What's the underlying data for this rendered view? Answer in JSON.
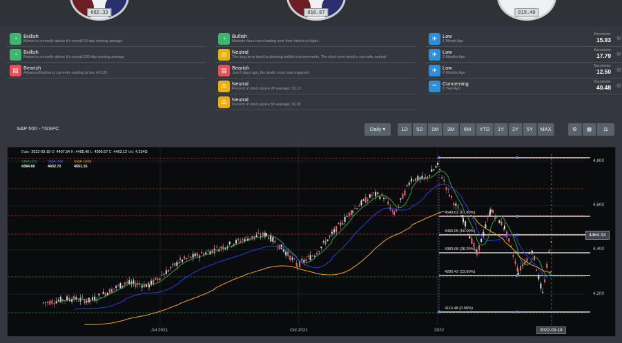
{
  "gauges": [
    {
      "value": "082.33"
    },
    {
      "value": "016.67"
    },
    {
      "value": "019.40"
    }
  ],
  "signals": {
    "col1": [
      {
        "title": "Bullish",
        "desc": "Market is currently above it's overall 50-day moving average",
        "color": "green",
        "icon": "gauge-icon"
      },
      {
        "title": "Bullish",
        "desc": "Market is currently above it's overall 200-day moving average",
        "color": "green",
        "icon": "gauge-icon"
      },
      {
        "title": "Bearish",
        "desc": "Advance/Decline is currently reading at low of 0.35",
        "color": "red",
        "icon": "chat-icon"
      }
    ],
    "col2": [
      {
        "title": "Bullish",
        "desc": "Markets have been trading near their historical highs.",
        "color": "green",
        "icon": "gauge-icon"
      },
      {
        "title": "Neutral",
        "desc": "The long term trend is showing bullish improvements. The short term trend is currently neutral.",
        "color": "yellow",
        "icon": "scale-icon"
      },
      {
        "title": "Bearish",
        "desc": "Just 6 days ago, the death cross was triggered",
        "color": "red",
        "icon": "chat-icon"
      },
      {
        "title": "Neutral",
        "desc": "Percent of stock above 20 average: 33.13",
        "color": "yellow",
        "icon": "scale-icon"
      },
      {
        "title": "Neutral",
        "desc": "Percent of stock above 50 average: 36.65",
        "color": "yellow",
        "icon": "scale-icon"
      }
    ],
    "col3": [
      {
        "title": "Low",
        "desc": "1 Month Ago",
        "label": "Barometer",
        "value": "15.93",
        "icon": "plane-icon"
      },
      {
        "title": "Low",
        "desc": "3 Months Ago",
        "label": "Barometer",
        "value": "17.79",
        "icon": "plane-icon"
      },
      {
        "title": "Low",
        "desc": "6 Months Ago",
        "label": "Barometer",
        "value": "12.50",
        "icon": "plane-icon"
      },
      {
        "title": "Concerning",
        "desc": "1 Year Ago",
        "label": "Barometer",
        "value": "40.48",
        "icon": "dots-icon"
      }
    ]
  },
  "section": {
    "title": "S&P 500 - ^GSPC",
    "interval": "Daily ▾",
    "ranges": [
      "1D",
      "5D",
      "1M",
      "3M",
      "6M",
      "YTD",
      "1Y",
      "2Y",
      "5Y",
      "MAX"
    ]
  },
  "ohlc": {
    "date_label": "Date:",
    "date": "2022-03-18",
    "o_label": "O:",
    "o": "4407.34",
    "h_label": "H:",
    "h": "4465.40",
    "l_label": "L:",
    "l": "4390.57",
    "c_label": "C:",
    "c": "4463.12",
    "vol_label": "Vol:",
    "vol": "4.234G"
  },
  "legend": [
    {
      "name": "SMA (20)",
      "value": "4384.66",
      "color": "#2fa34a"
    },
    {
      "name": "SMA (50)",
      "value": "4432.72",
      "color": "#2f3fd9"
    },
    {
      "name": "SMA (100)",
      "value": "4551.15",
      "color": "#f5a623"
    }
  ],
  "price_flag": "4464.33",
  "x_labels": [
    "Jul 2021",
    "Oct 2021",
    "2022",
    "2022-03-18"
  ],
  "y_labels": [
    "4,800",
    "4,600",
    "4,400",
    "4,200"
  ],
  "fib_levels": [
    "4549.02 (61.80%)",
    "4466.05 (50.00%)",
    "4383.08 (38.20%)",
    "4280.42 (23.60%)",
    "4114.48 (0.00%)"
  ],
  "colors": {
    "bull": "#2fa34a",
    "bear": "#e05358",
    "fib": "#ffffff",
    "background": "#090b0d"
  }
}
